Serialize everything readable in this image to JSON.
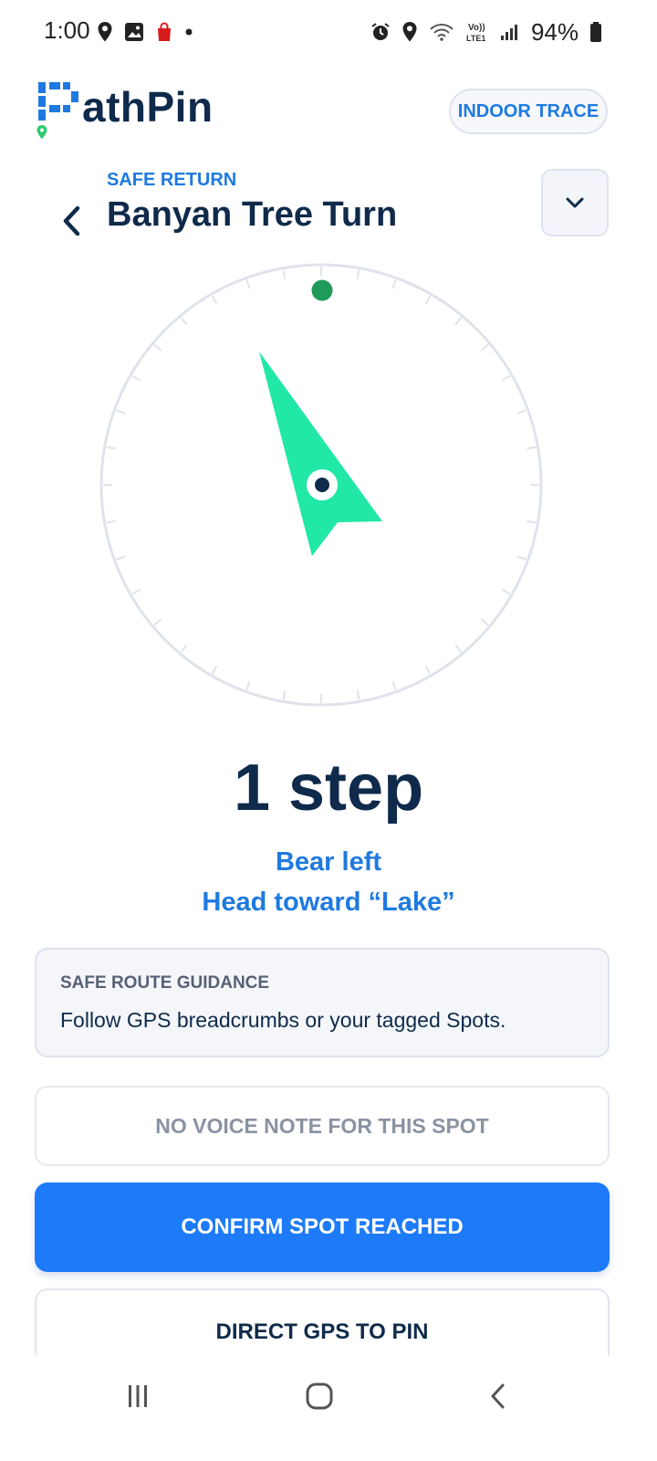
{
  "status_bar": {
    "time": "1:00",
    "battery": "94%",
    "network": "LTE1"
  },
  "app": {
    "logo_text": "athPin",
    "indoor_button": "INDOOR TRACE"
  },
  "header": {
    "eyebrow": "SAFE RETURN",
    "title": "Banyan Tree Turn"
  },
  "navigation": {
    "distance": "1 step",
    "direction_line1": "Bear left",
    "direction_line2": "Head toward “Lake”"
  },
  "guidance": {
    "title": "SAFE ROUTE GUIDANCE",
    "body": "Follow GPS breadcrumbs or your tagged Spots."
  },
  "voice_note": "NO VOICE NOTE FOR THIS SPOT",
  "buttons": {
    "confirm": "CONFIRM SPOT REACHED",
    "direct_gps": "DIRECT GPS TO PIN"
  },
  "colors": {
    "accent": "#1e7ae0",
    "primary_button": "#1d7af8",
    "arrow": "#21e8a6",
    "north_dot": "#1e9a5a",
    "text_dark": "#0f2a4a"
  },
  "icons": {
    "back": "chevron-left-icon",
    "dropdown": "chevron-down-icon",
    "nav_recents": "recents-icon",
    "nav_home": "home-icon",
    "nav_back": "back-icon"
  }
}
